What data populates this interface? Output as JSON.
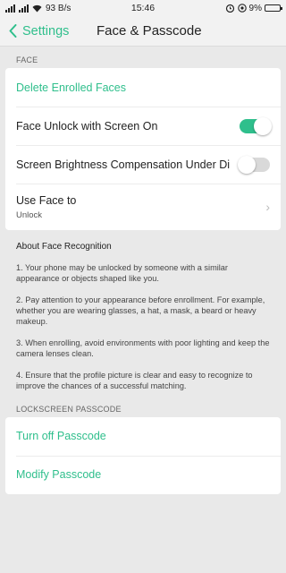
{
  "status_bar": {
    "network": "93 B/s",
    "time": "15:46",
    "battery": "9%"
  },
  "nav": {
    "back_label": "Settings",
    "title": "Face & Passcode"
  },
  "face_section": {
    "header": "FACE",
    "delete_label": "Delete Enrolled Faces",
    "face_unlock_label": "Face Unlock with Screen On",
    "face_unlock_on": true,
    "brightness_label": "Screen Brightness Compensation Under Di...",
    "brightness_on": false,
    "use_face_label": "Use Face to",
    "use_face_value": "Unlock"
  },
  "about": {
    "title": "About Face Recognition",
    "points": [
      "1. Your phone may be unlocked by someone with a similar appearance or objects shaped like you.",
      "2. Pay attention to your appearance before enrollment. For example, whether you are wearing glasses, a hat, a mask, a beard or heavy makeup.",
      "3. When enrolling, avoid environments with poor lighting and keep the camera lenses clean.",
      "4. Ensure that the profile picture is clear and easy to recognize to improve the chances of a successful matching."
    ]
  },
  "passcode_section": {
    "header": "LOCKSCREEN PASSCODE",
    "turn_off_label": "Turn off Passcode",
    "modify_label": "Modify Passcode"
  },
  "colors": {
    "accent": "#2fbf8c",
    "background": "#e9e9e9",
    "card": "#ffffff"
  }
}
